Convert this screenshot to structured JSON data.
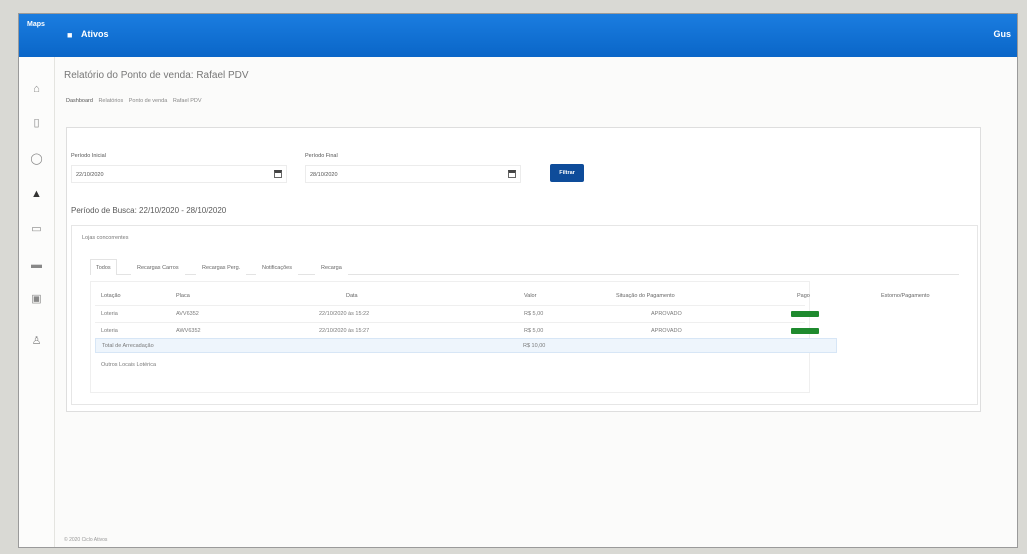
{
  "header": {
    "brand": "Maps",
    "menu_icon": "grid-icon",
    "app_name": "Ativos",
    "user": "Gus"
  },
  "sidebar": {
    "icons": [
      "home-icon",
      "document-icon",
      "shield-icon",
      "car-icon",
      "calendar-icon",
      "card-icon",
      "money-icon",
      "user-icon"
    ]
  },
  "page": {
    "title": "Relatório do Ponto de venda: Rafael PDV",
    "breadcrumb": [
      "Dashboard",
      "Relatórios",
      "Ponto de venda",
      "Rafael PDV"
    ]
  },
  "filters": {
    "start_label": "Período Inicial",
    "start_value": "22/10/2020",
    "end_label": "Período Final",
    "end_value": "28/10/2020",
    "button": "Filtrar"
  },
  "results": {
    "period": "Período de Busca: 22/10/2020 - 28/10/2020",
    "fill_text": "Lojas concorrentes",
    "tabs": [
      "Todos",
      "Recargas Carros",
      "Recargas Perg.",
      "Notificações",
      "Recarga"
    ],
    "columns": [
      "Lotação",
      "Placa",
      "Data",
      "Valor",
      "Situação do Pagamento",
      "Pago",
      "Estorno/Pagamento"
    ],
    "rows": [
      {
        "lotacao": "Loteria",
        "placa": "AVV6352",
        "data": "22/10/2020 às 15:22",
        "valor": "R$ 5,00",
        "situacao": "APROVADO"
      },
      {
        "lotacao": "Loteria",
        "placa": "AWV6352",
        "data": "22/10/2020 às 15:27",
        "valor": "R$ 5,00",
        "situacao": "APROVADO"
      }
    ],
    "total_label": "Total de Arrecadação",
    "total_value": "R$ 10,00",
    "note": "Outros Locais Lotérica"
  },
  "footer": "© 2020 Ciclo Ativos",
  "colors": {
    "primary": "#0a66c8",
    "button": "#0e4c9a",
    "paid": "#1e8a2e"
  }
}
